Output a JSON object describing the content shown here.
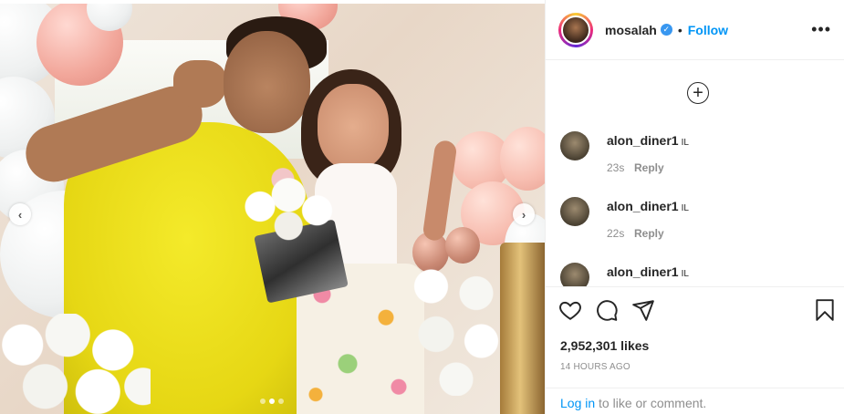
{
  "post": {
    "username": "mosalah",
    "verified_icon": "verified-badge-icon",
    "separator": "•",
    "follow_label": "Follow",
    "more_icon": "more-options-icon",
    "more_glyph": "•••"
  },
  "carousel": {
    "prev_glyph": "‹",
    "next_glyph": "›",
    "slide_count": 3,
    "active_slide": 2
  },
  "comments": {
    "load_more_glyph": "+",
    "items": [
      {
        "username": "alon_diner1",
        "text": "IL",
        "time": "23s",
        "reply_label": "Reply"
      },
      {
        "username": "alon_diner1",
        "text": "IL",
        "time": "22s",
        "reply_label": "Reply"
      },
      {
        "username": "alon_diner1",
        "text": "IL",
        "time": "",
        "reply_label": ""
      }
    ]
  },
  "actions": {
    "like_icon": "heart-icon",
    "comment_icon": "comment-icon",
    "share_icon": "share-icon",
    "save_icon": "bookmark-icon",
    "likes_text": "2,952,301 likes",
    "time_ago": "14 HOURS AGO",
    "login_link": "Log in",
    "login_rest": " to like or comment."
  },
  "colors": {
    "accent": "#0095f6",
    "muted": "#8e8e8e",
    "text": "#262626"
  }
}
